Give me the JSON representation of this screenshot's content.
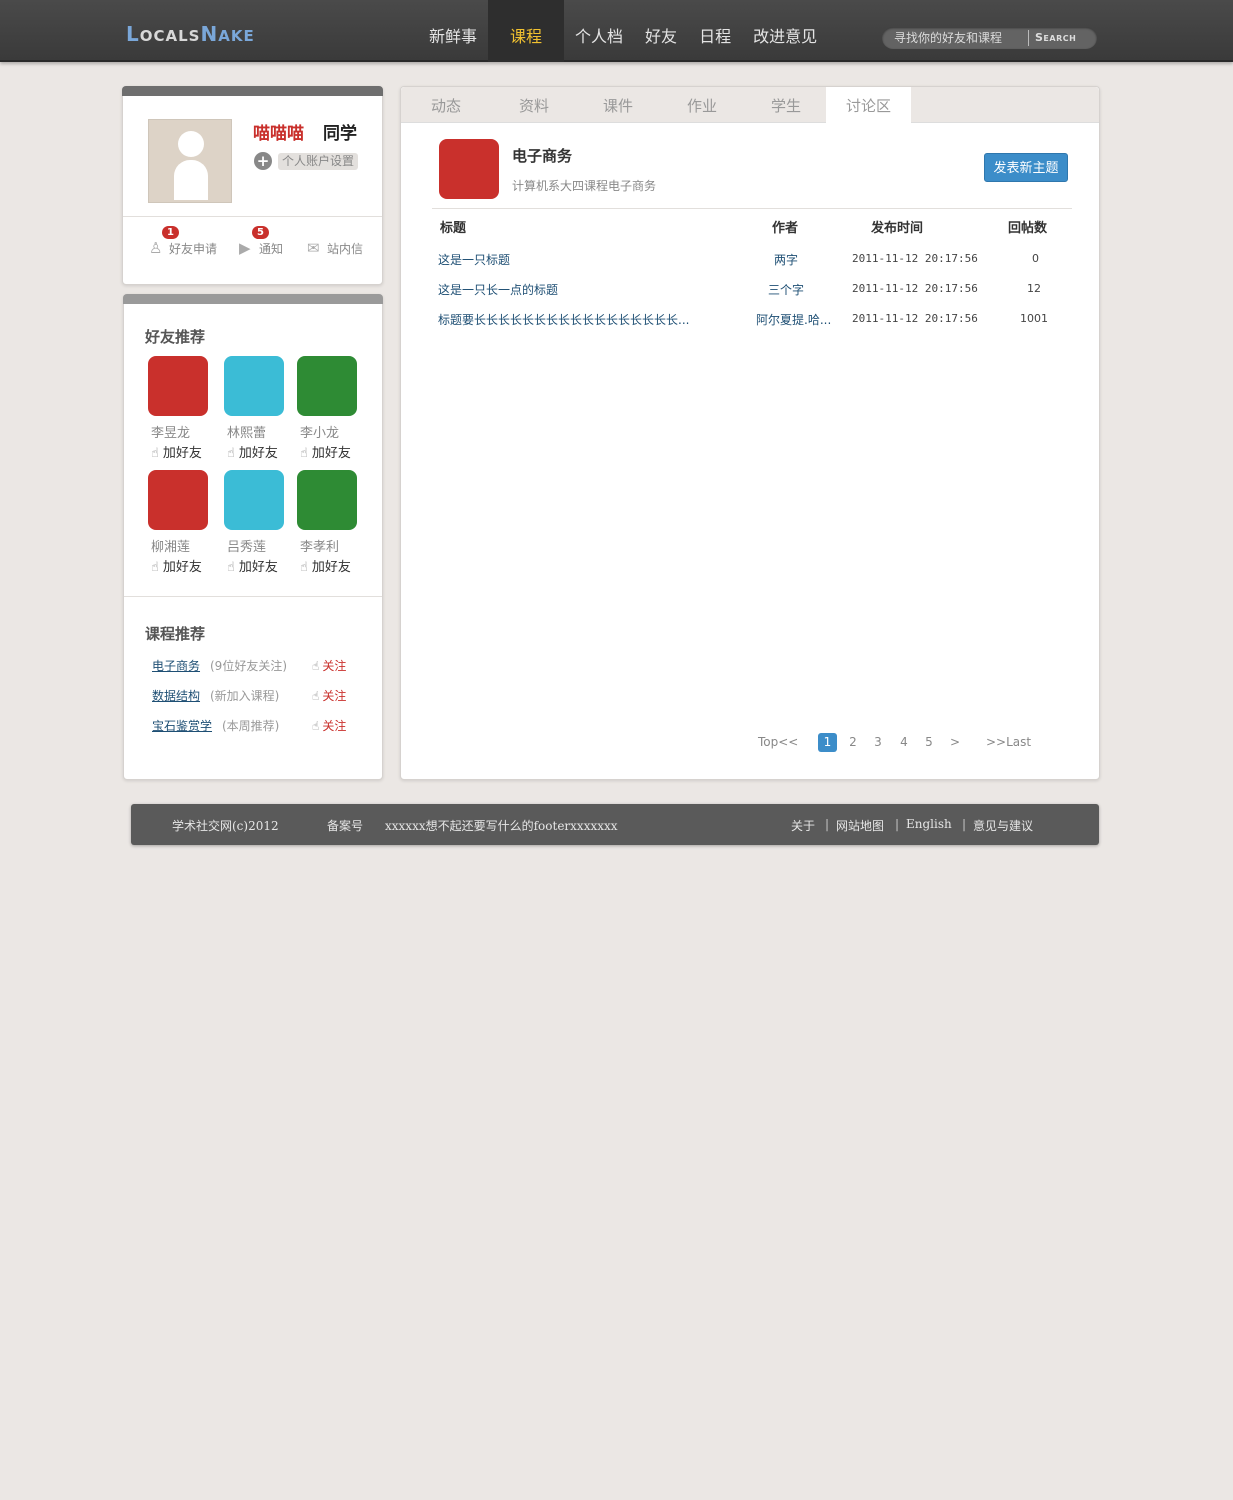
{
  "header": {
    "logo": {
      "a": "L",
      "b": "OCALS",
      "c": "N",
      "d": "AKE"
    },
    "nav": [
      "新鲜事",
      "课程",
      "个人档",
      "好友",
      "日程",
      "改进意见"
    ],
    "active_nav": "课程",
    "search_placeholder": "寻找你的好友和课程",
    "search_button": "Search"
  },
  "profile": {
    "name": "喵喵喵",
    "role": "同学",
    "account_settings": "个人账户设置",
    "links": [
      {
        "label": "好友申请",
        "badge": "1",
        "icon": "add-user-icon"
      },
      {
        "label": "通知",
        "badge": "5",
        "icon": "notification-icon"
      },
      {
        "label": "站内信",
        "badge": "",
        "icon": "mail-icon"
      }
    ]
  },
  "friends_recommend": {
    "title": "好友推荐",
    "add_label": "加好友",
    "friends": [
      {
        "name": "李昱龙",
        "color": "#c9302c"
      },
      {
        "name": "林熙蕾",
        "color": "#3bbcd6"
      },
      {
        "name": "李小龙",
        "color": "#2e8b34"
      },
      {
        "name": "柳湘莲",
        "color": "#c9302c"
      },
      {
        "name": "吕秀莲",
        "color": "#3bbcd6"
      },
      {
        "name": "李孝利",
        "color": "#2e8b34"
      }
    ]
  },
  "course_recommend": {
    "title": "课程推荐",
    "follow_label": "关注",
    "courses": [
      {
        "name": "电子商务",
        "note": "(9位好友关注)"
      },
      {
        "name": "数据结构",
        "note": "(新加入课程)"
      },
      {
        "name": "宝石鉴赏学",
        "note": "(本周推荐)"
      }
    ]
  },
  "main": {
    "tabs": [
      "动态",
      "资料",
      "课件",
      "作业",
      "学生",
      "讨论区"
    ],
    "active_tab": "讨论区",
    "course_title": "电子商务",
    "course_desc": "计算机系大四课程电子商务",
    "new_topic_button": "发表新主题",
    "table": {
      "headers": [
        "标题",
        "作者",
        "发布时间",
        "回帖数"
      ],
      "rows": [
        {
          "title": "这是一只标题",
          "author": "两字",
          "time": "2011-11-12 20:17:56",
          "replies": "0"
        },
        {
          "title": "这是一只长一点的标题",
          "author": "三个字",
          "time": "2011-11-12 20:17:56",
          "replies": "12"
        },
        {
          "title": "标题要长长长长长长长长长长长长长长长长长...",
          "author": "阿尔夏提.哈...",
          "time": "2011-11-12 20:17:56",
          "replies": "1001"
        }
      ]
    },
    "pager": {
      "first": "Top<<",
      "pages": [
        "1",
        "2",
        "3",
        "4",
        "5"
      ],
      "current": "1",
      "next": ">",
      "last": ">>Last"
    }
  },
  "footer": {
    "copyright": "学术社交网(c)2012",
    "icp_label": "备案号",
    "icp_text": "xxxxxx想不起还要写什么的footerxxxxxxx",
    "links": [
      "关于",
      "网站地图",
      "English",
      "意见与建议"
    ]
  }
}
